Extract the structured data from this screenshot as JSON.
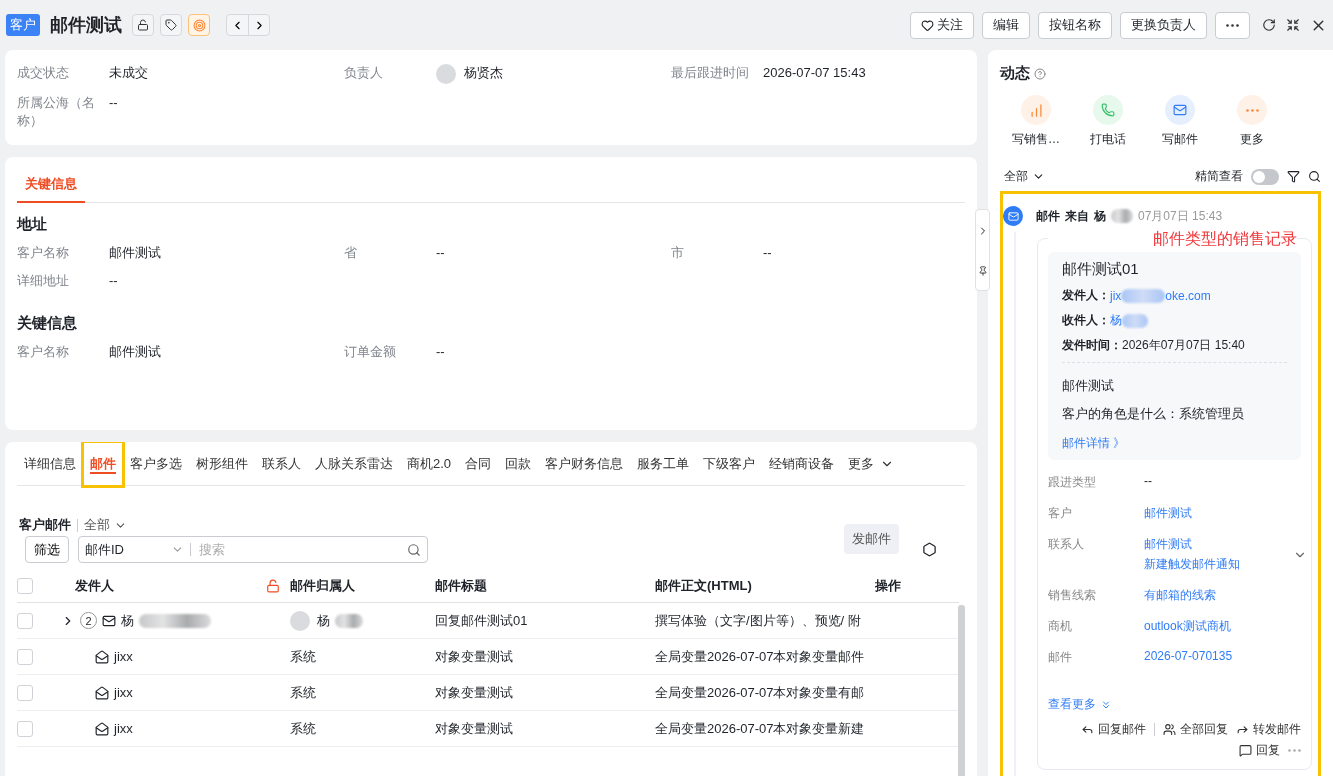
{
  "header": {
    "badge": "客户",
    "title": "邮件测试",
    "actions": [
      {
        "label": "关注",
        "kind": "follow"
      },
      {
        "label": "编辑",
        "kind": "plain"
      },
      {
        "label": "按钮名称",
        "kind": "plain"
      },
      {
        "label": "更换负责人",
        "kind": "plain"
      }
    ]
  },
  "summary": [
    {
      "label": "成交状态",
      "value": "未成交",
      "kind": "text"
    },
    {
      "label": "负责人",
      "value": "杨贤杰",
      "kind": "person"
    },
    {
      "label": "最后跟进时间",
      "value": "2026-07-07 15:43",
      "kind": "text"
    },
    {
      "label": "所属公海（名称）",
      "value": "--",
      "kind": "text"
    }
  ],
  "detail_card": {
    "tabs": [
      {
        "label": "关键信息",
        "selected": true
      }
    ],
    "sections": [
      {
        "title": "地址",
        "fields": [
          {
            "label": "客户名称",
            "value": "邮件测试"
          },
          {
            "label": "省",
            "value": "--"
          },
          {
            "label": "市",
            "value": "--"
          },
          {
            "label": "详细地址",
            "value": "--"
          }
        ]
      },
      {
        "title": "关键信息",
        "fields": [
          {
            "label": "客户名称",
            "value": "邮件测试"
          },
          {
            "label": "订单金额",
            "value": "--"
          }
        ]
      }
    ]
  },
  "related": {
    "tabs": [
      {
        "label": "详细信息",
        "selected": false,
        "highlighted": false
      },
      {
        "label": "邮件",
        "selected": true,
        "highlighted": true
      },
      {
        "label": "客户多选",
        "selected": false,
        "highlighted": false
      },
      {
        "label": "树形组件",
        "selected": false,
        "highlighted": false
      },
      {
        "label": "联系人",
        "selected": false,
        "highlighted": false
      },
      {
        "label": "人脉关系雷达",
        "selected": false,
        "highlighted": false
      },
      {
        "label": "商机2.0",
        "selected": false,
        "highlighted": false
      },
      {
        "label": "合同",
        "selected": false,
        "highlighted": false
      },
      {
        "label": "回款",
        "selected": false,
        "highlighted": false
      },
      {
        "label": "客户财务信息",
        "selected": false,
        "highlighted": false
      },
      {
        "label": "服务工单",
        "selected": false,
        "highlighted": false
      },
      {
        "label": "下级客户",
        "selected": false,
        "highlighted": false
      },
      {
        "label": "经销商设备",
        "selected": false,
        "highlighted": false
      }
    ],
    "more_tab": "更多",
    "list_title": "客户邮件",
    "scope": "全部",
    "filter_button": "筛选",
    "search_field": "邮件ID",
    "search": {
      "placeholder": "搜索"
    },
    "send_button": "发邮件",
    "columns": [
      "发件人",
      "邮件归属人",
      "邮件标题",
      "邮件正文(HTML)",
      "操作"
    ],
    "all_checked": false,
    "rows": [
      {
        "kind": "group",
        "checked": false,
        "count": "2",
        "sender": "杨",
        "owner": "杨",
        "title": "回复邮件测试01",
        "body": "撰写体验（文字/图片等）、预览/ 附"
      },
      {
        "kind": "child",
        "checked": false,
        "sender": "jixx",
        "owner": "系统",
        "title": "对象变量测试",
        "body": "全局变量2026-07-07本对象变量邮件"
      },
      {
        "kind": "child",
        "checked": false,
        "sender": "jixx",
        "owner": "系统",
        "title": "对象变量测试",
        "body": "全局变量2026-07-07本对象变量有邮"
      },
      {
        "kind": "child",
        "checked": false,
        "sender": "jixx",
        "owner": "系统",
        "title": "对象变量测试",
        "body": "全局变量2026-07-07本对象变量新建"
      }
    ]
  },
  "activity": {
    "title": "动态",
    "quick_actions": [
      {
        "label": "写销售…",
        "kind": "chart"
      },
      {
        "label": "打电话",
        "kind": "phone"
      },
      {
        "label": "写邮件",
        "kind": "mail"
      },
      {
        "label": "更多",
        "kind": "more"
      }
    ],
    "scope": "全部",
    "compact_label": "精简查看",
    "compact_on": false,
    "item": {
      "highlighted": true,
      "kind_label": "邮件",
      "from_label": "来自",
      "from": "杨",
      "time": "07月07日 15:43",
      "annotation": "邮件类型的销售记录",
      "subject": "邮件测试01",
      "meta": [
        {
          "label": "发件人：",
          "parts": [
            "jix",
            "oke.com"
          ],
          "kind": "link"
        },
        {
          "label": "收件人：",
          "parts": [
            "杨"
          ],
          "kind": "link"
        },
        {
          "label": "发件时间：",
          "parts": [
            "2026年07月07日 15:40"
          ],
          "kind": "text"
        }
      ],
      "body": [
        "邮件测试",
        "客户的角色是什么：系统管理员"
      ],
      "detail_link": "邮件详情 》",
      "fields": [
        {
          "label": "跟进类型",
          "values": [
            "--"
          ],
          "kind": "text"
        },
        {
          "label": "客户",
          "values": [
            "邮件测试"
          ],
          "kind": "link"
        },
        {
          "label": "联系人",
          "values": [
            "邮件测试",
            "新建触发邮件通知"
          ],
          "kind": "link"
        },
        {
          "label": "销售线索",
          "values": [
            "有邮箱的线索"
          ],
          "kind": "link"
        },
        {
          "label": "商机",
          "values": [
            "outlook测试商机"
          ],
          "kind": "link"
        },
        {
          "label": "邮件",
          "values": [
            "2026-07-070135"
          ],
          "kind": "link"
        }
      ],
      "see_more": "查看更多",
      "reply_actions": [
        "回复邮件",
        "全部回复",
        "转发邮件"
      ],
      "comment": "回复"
    }
  }
}
